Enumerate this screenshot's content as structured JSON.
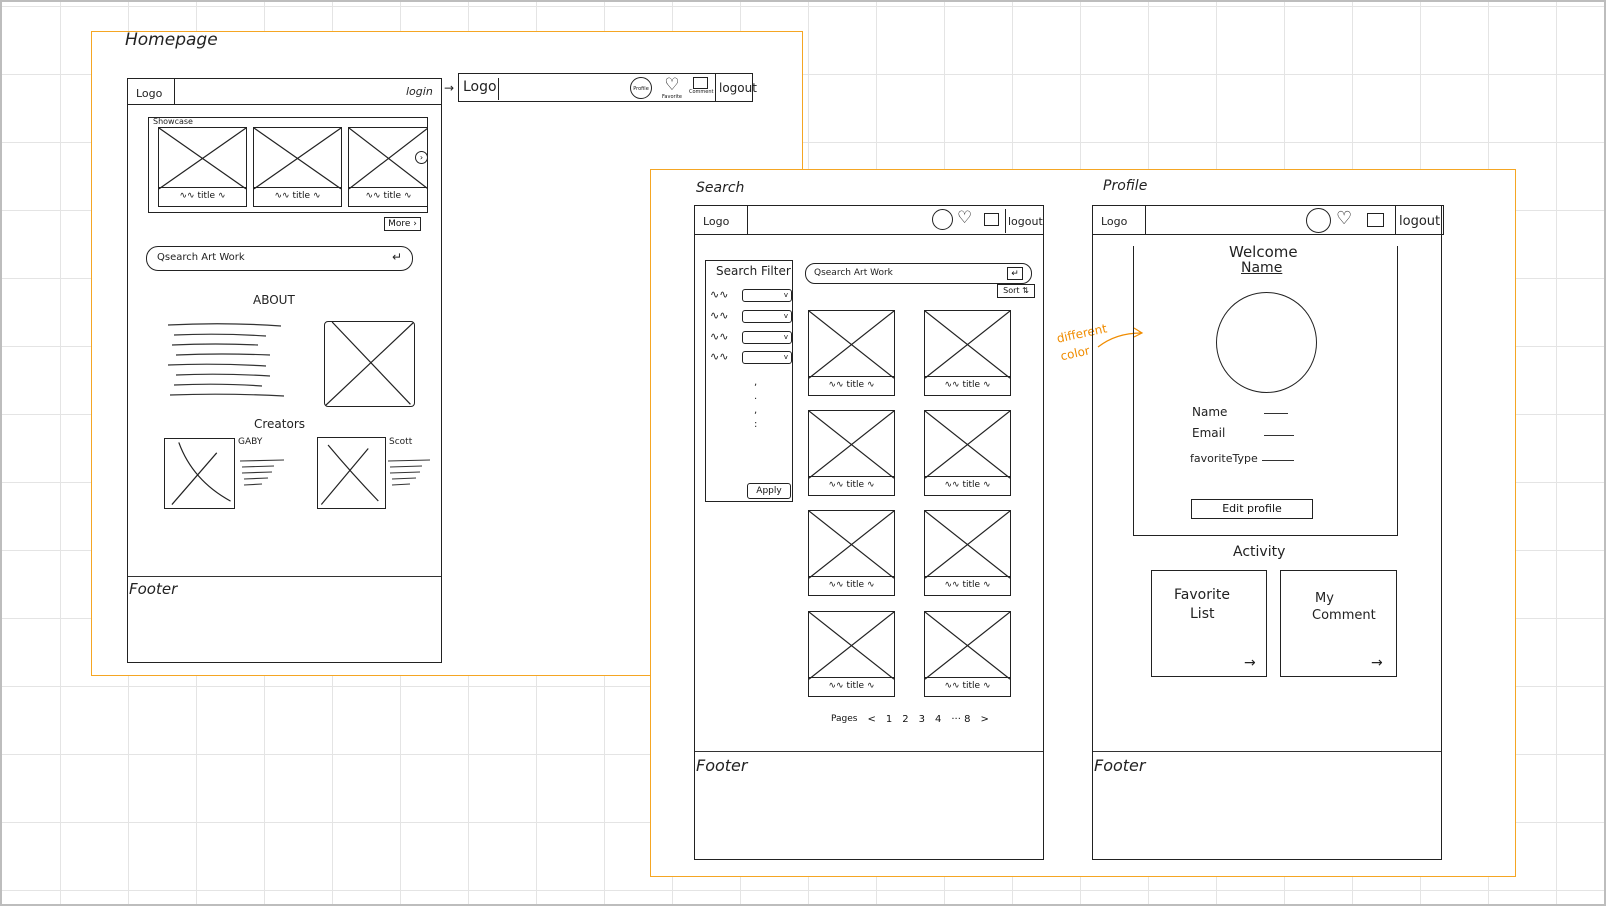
{
  "homepage": {
    "label": "Homepage",
    "header": {
      "logo": "Logo",
      "login": "login"
    },
    "alt_header": {
      "logo": "Logo",
      "icons": [
        "Profile",
        "Favorite",
        "Comment"
      ],
      "logout": "logout"
    },
    "showcase": {
      "label": "Showcase",
      "card_caption": "title",
      "more": "More"
    },
    "search": {
      "placeholder": "Qsearch Art Work"
    },
    "about_title": "ABOUT",
    "creators": {
      "title": "Creators",
      "items": [
        {
          "name": "GABY"
        },
        {
          "name": "Scott"
        }
      ]
    },
    "footer": "Footer"
  },
  "search_page": {
    "label": "Search",
    "header": {
      "logo": "Logo",
      "logout": "logout"
    },
    "filter": {
      "title": "Search Filter",
      "apply": "Apply"
    },
    "search": {
      "placeholder": "Qsearch Art Work"
    },
    "sort": "Sort",
    "card_caption": "title",
    "pagination": {
      "label": "Pages",
      "prev": "<",
      "pages": [
        "1",
        "2",
        "3",
        "4",
        "··· 8"
      ],
      "next": ">"
    },
    "annotation": [
      "different",
      "color"
    ],
    "footer": "Footer"
  },
  "profile_page": {
    "label": "Profile",
    "header": {
      "logo": "Logo",
      "logout": "logout"
    },
    "welcome": "Welcome",
    "welcome_name": "Name",
    "fields": [
      {
        "label": "Name"
      },
      {
        "label": "Email"
      },
      {
        "label": "favoriteType"
      }
    ],
    "edit_profile": "Edit profile",
    "activity": {
      "title": "Activity",
      "favorite_list": [
        "Favorite",
        "List"
      ],
      "my_comment": [
        "My",
        "Comment"
      ]
    },
    "footer": "Footer"
  },
  "colors": {
    "frame": "#f5a623",
    "ink": "#222222",
    "annotation": "#f08c00",
    "grid": "#e4e4e4"
  }
}
